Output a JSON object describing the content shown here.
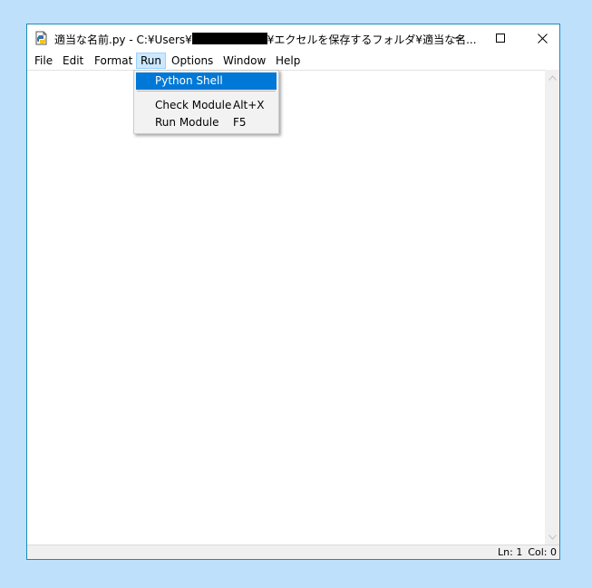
{
  "window": {
    "title_part1": "適当な名前.py - C:¥Users¥",
    "title_part2": "¥エクセルを保存するフォルダ¥適当な名...",
    "icon": "python-file-icon"
  },
  "controls": {
    "minimize_icon": "minimize-icon",
    "maximize_icon": "maximize-icon",
    "close_icon": "close-icon"
  },
  "menubar": {
    "items": [
      "File",
      "Edit",
      "Format",
      "Run",
      "Options",
      "Window",
      "Help"
    ],
    "active": "Run"
  },
  "run_menu": {
    "python_shell": "Python Shell",
    "check_module": "Check Module",
    "check_module_shortcut": "Alt+X",
    "run_module": "Run Module",
    "run_module_shortcut": "F5"
  },
  "statusbar": {
    "line": "Ln: 1",
    "column": "Col: 0"
  },
  "colors": {
    "desktop": "#bfe0fb",
    "window_border": "#1b8bb5",
    "menu_highlight": "#0078d7",
    "active_menu_bg": "#cce8ff"
  }
}
